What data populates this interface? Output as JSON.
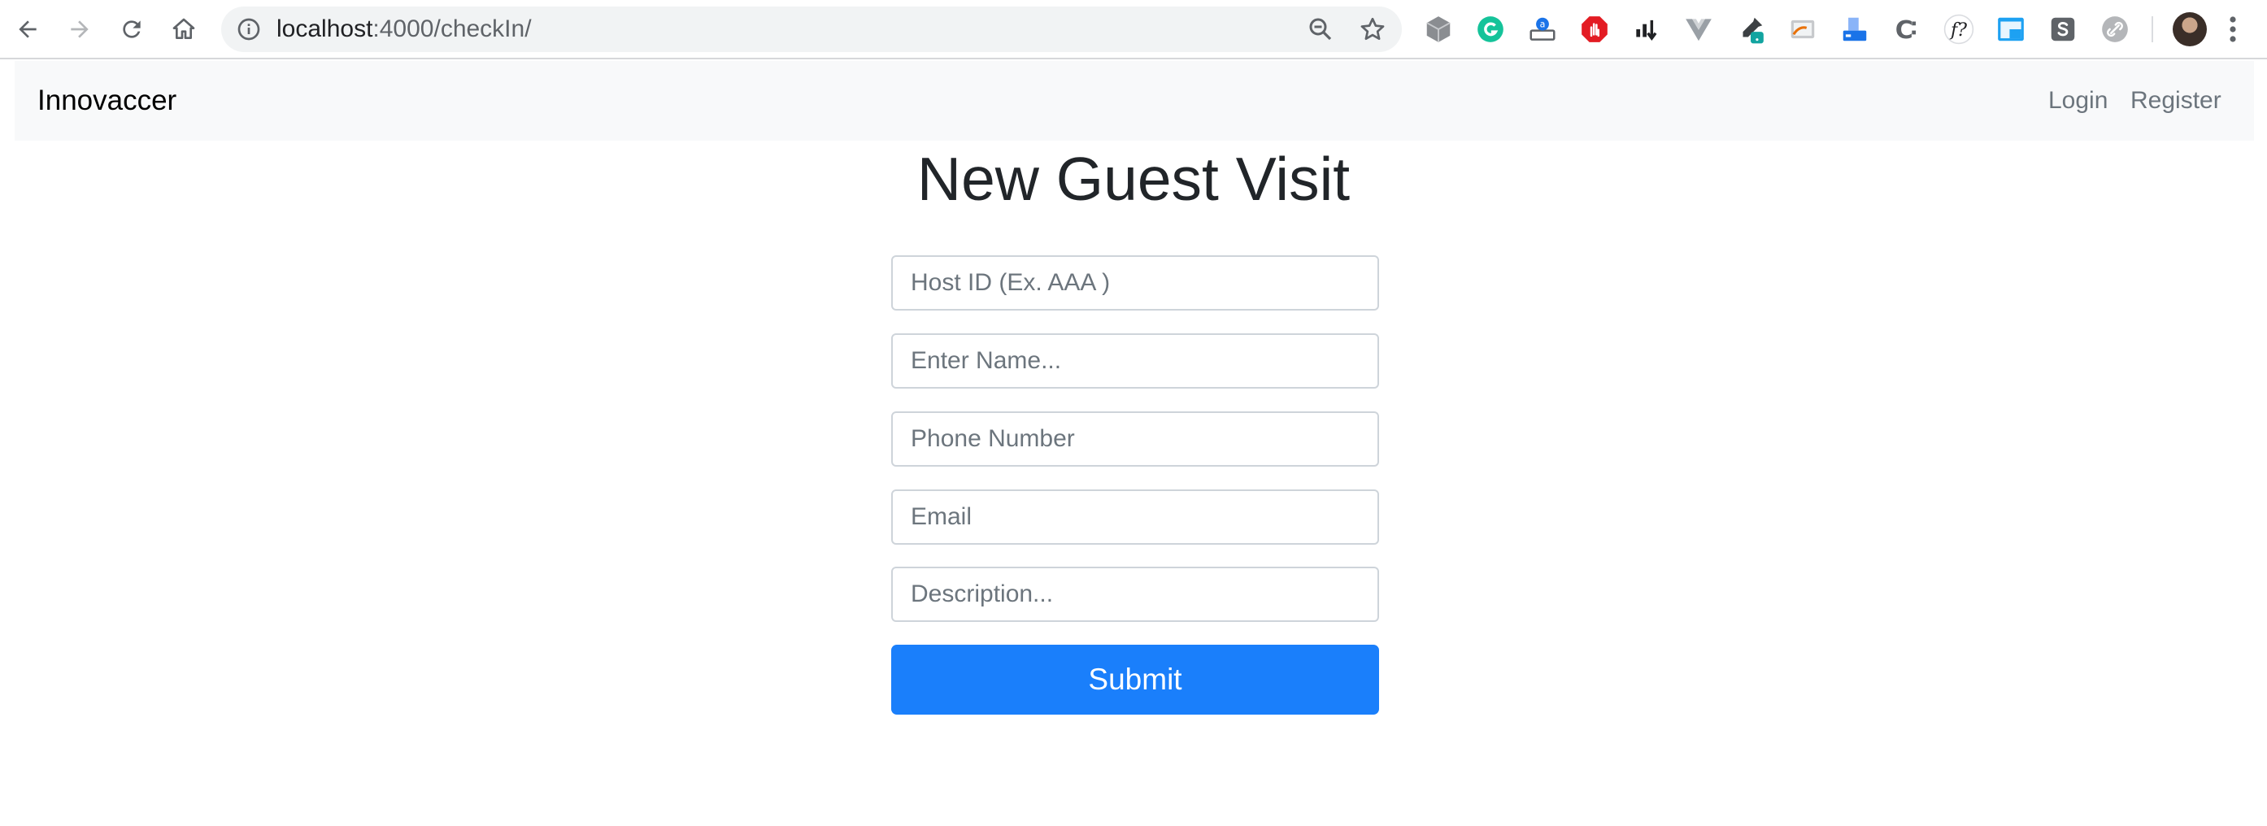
{
  "browser": {
    "url_host": "localhost",
    "url_path": ":4000/checkIn/",
    "icons": [
      "back-icon",
      "forward-icon",
      "reload-icon",
      "home-icon",
      "info-icon",
      "zoom-icon",
      "bookmark-star-icon",
      "menu-icon"
    ],
    "extensions": [
      "cube-extension-icon",
      "grammarly-icon",
      "printer-extension-icon",
      "adblock-icon",
      "chart-extension-icon",
      "vue-devtools-icon",
      "eyedropper-icon",
      "screencast-icon",
      "scanner-icon",
      "extension-c-icon",
      "font-extension-icon",
      "window-extension-icon",
      "s-extension-icon",
      "link-extension-icon"
    ],
    "extension_f_label": "f?",
    "extension_c_label": "C"
  },
  "navbar": {
    "brand": "Innovaccer",
    "links": [
      "Login",
      "Register"
    ]
  },
  "form": {
    "title": "New Guest Visit",
    "fields": [
      {
        "placeholder": "Host ID (Ex. AAA )",
        "value": ""
      },
      {
        "placeholder": "Enter Name...",
        "value": ""
      },
      {
        "placeholder": "Phone Number",
        "value": ""
      },
      {
        "placeholder": "Email",
        "value": ""
      },
      {
        "placeholder": "Description...",
        "value": ""
      }
    ],
    "submit_label": "Submit"
  },
  "colors": {
    "primary": "#1a7ffb",
    "navbar_bg": "#f8f9fa",
    "border": "#ced4da",
    "grammarly": "#15c39a",
    "adblock": "#e31c23"
  }
}
